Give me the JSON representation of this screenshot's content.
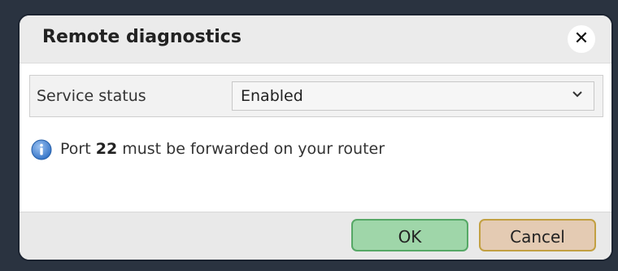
{
  "dialog": {
    "title": "Remote diagnostics",
    "close_icon": "close-icon"
  },
  "field": {
    "label": "Service status",
    "selected_value": "Enabled",
    "chevron_icon": "chevron-down-icon"
  },
  "info": {
    "icon": "info-icon",
    "text_before": "Port ",
    "port": "22",
    "text_after": " must be forwarded on your router"
  },
  "footer": {
    "ok_label": "OK",
    "cancel_label": "Cancel"
  },
  "colors": {
    "ok_fill": "#9fd6a9",
    "ok_border": "#56a866",
    "cancel_fill": "#e4cbb3",
    "cancel_border": "#c2a042",
    "info_blue": "#3a7bd5"
  }
}
